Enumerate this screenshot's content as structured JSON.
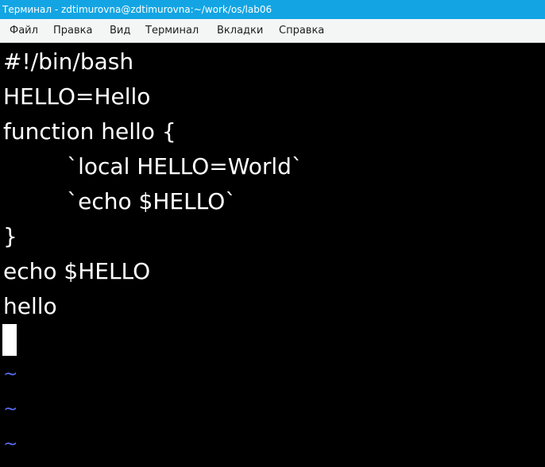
{
  "window": {
    "title": "Терминал - zdtimurovna@zdtimurovna:~/work/os/lab06"
  },
  "menu": {
    "items": [
      {
        "label": "Файл"
      },
      {
        "label": "Правка"
      },
      {
        "label": "Вид"
      },
      {
        "label": "Терминал"
      },
      {
        "label": "Вкладки"
      },
      {
        "label": "Справка"
      }
    ]
  },
  "editor": {
    "lines": [
      "#!/bin/bash",
      "HELLO=Hello",
      "function hello {",
      "         `local HELLO=World`",
      "         `echo $HELLO`",
      "}",
      "echo $HELLO",
      "hello"
    ],
    "empty_marker": "~"
  },
  "colors": {
    "titlebar_bg": "#13a5e3",
    "menubar_bg": "#f4f6f6",
    "terminal_bg": "#000000",
    "text": "#ffffff",
    "tilde": "#5b6cf4"
  }
}
